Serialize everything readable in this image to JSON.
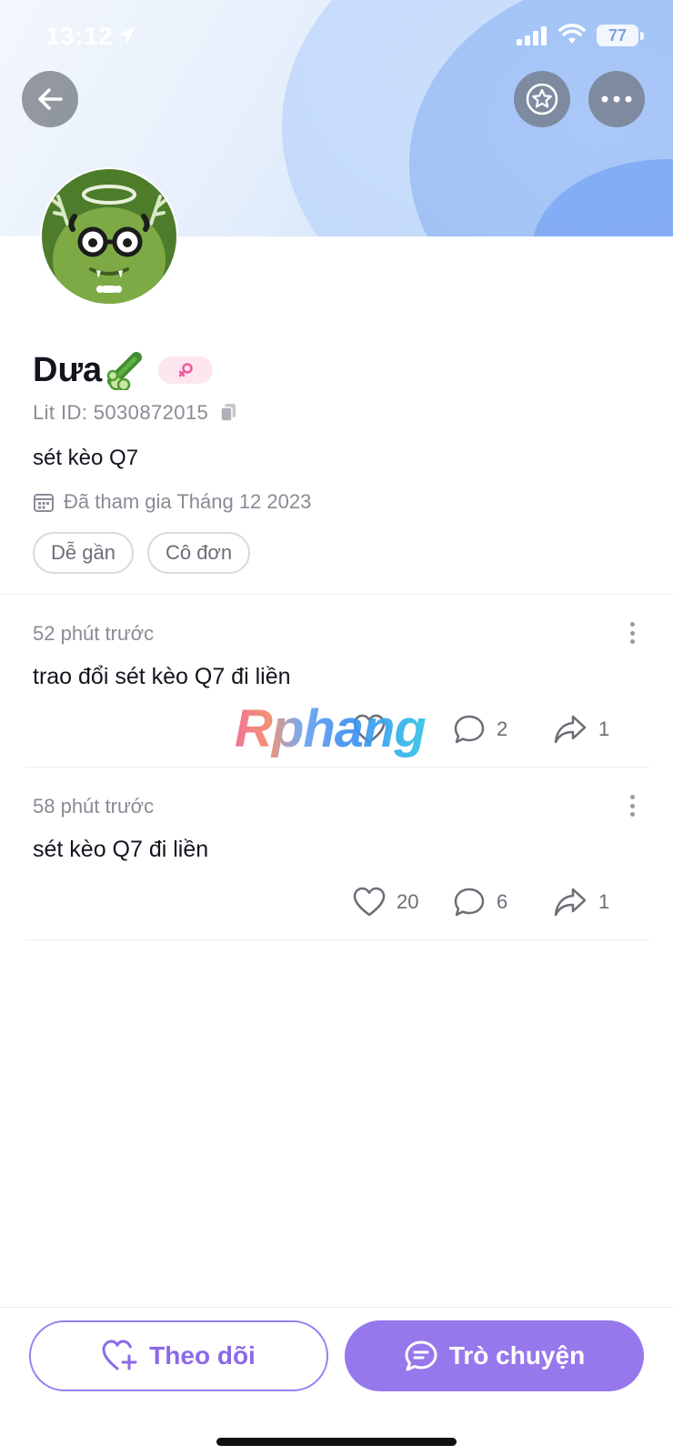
{
  "status_bar": {
    "time": "13:12",
    "battery": "77"
  },
  "profile": {
    "name": "Dưa",
    "lit_id": "Lit ID: 5030872015",
    "bio": "sét kèo Q7",
    "joined": "Đã tham gia Tháng 12 2023",
    "tags": [
      "Dễ gần",
      "Cô đơn"
    ],
    "gender_color": "#f0569a"
  },
  "posts": [
    {
      "time_ago": "52 phút trước",
      "text": "trao đổi sét kèo Q7 đi liền",
      "likes": "",
      "comments": "2",
      "shares": "1"
    },
    {
      "time_ago": "58 phút trước",
      "text": "sét kèo Q7 đi liền",
      "likes": "20",
      "comments": "6",
      "shares": "1"
    }
  ],
  "watermark": "Rphang",
  "bottom_bar": {
    "follow_label": "Theo dõi",
    "chat_label": "Trò chuyện"
  },
  "colors": {
    "accent": "#9678ec",
    "accent_text": "#8a6ae8"
  },
  "icons": [
    "location-arrow-icon",
    "signal-icon",
    "wifi-icon",
    "back-arrow-icon",
    "star-icon",
    "more-icon",
    "cucumber-icon",
    "female-icon",
    "copy-icon",
    "calendar-icon",
    "heart-icon",
    "comment-icon",
    "share-icon",
    "heart-plus-icon",
    "chat-icon"
  ]
}
